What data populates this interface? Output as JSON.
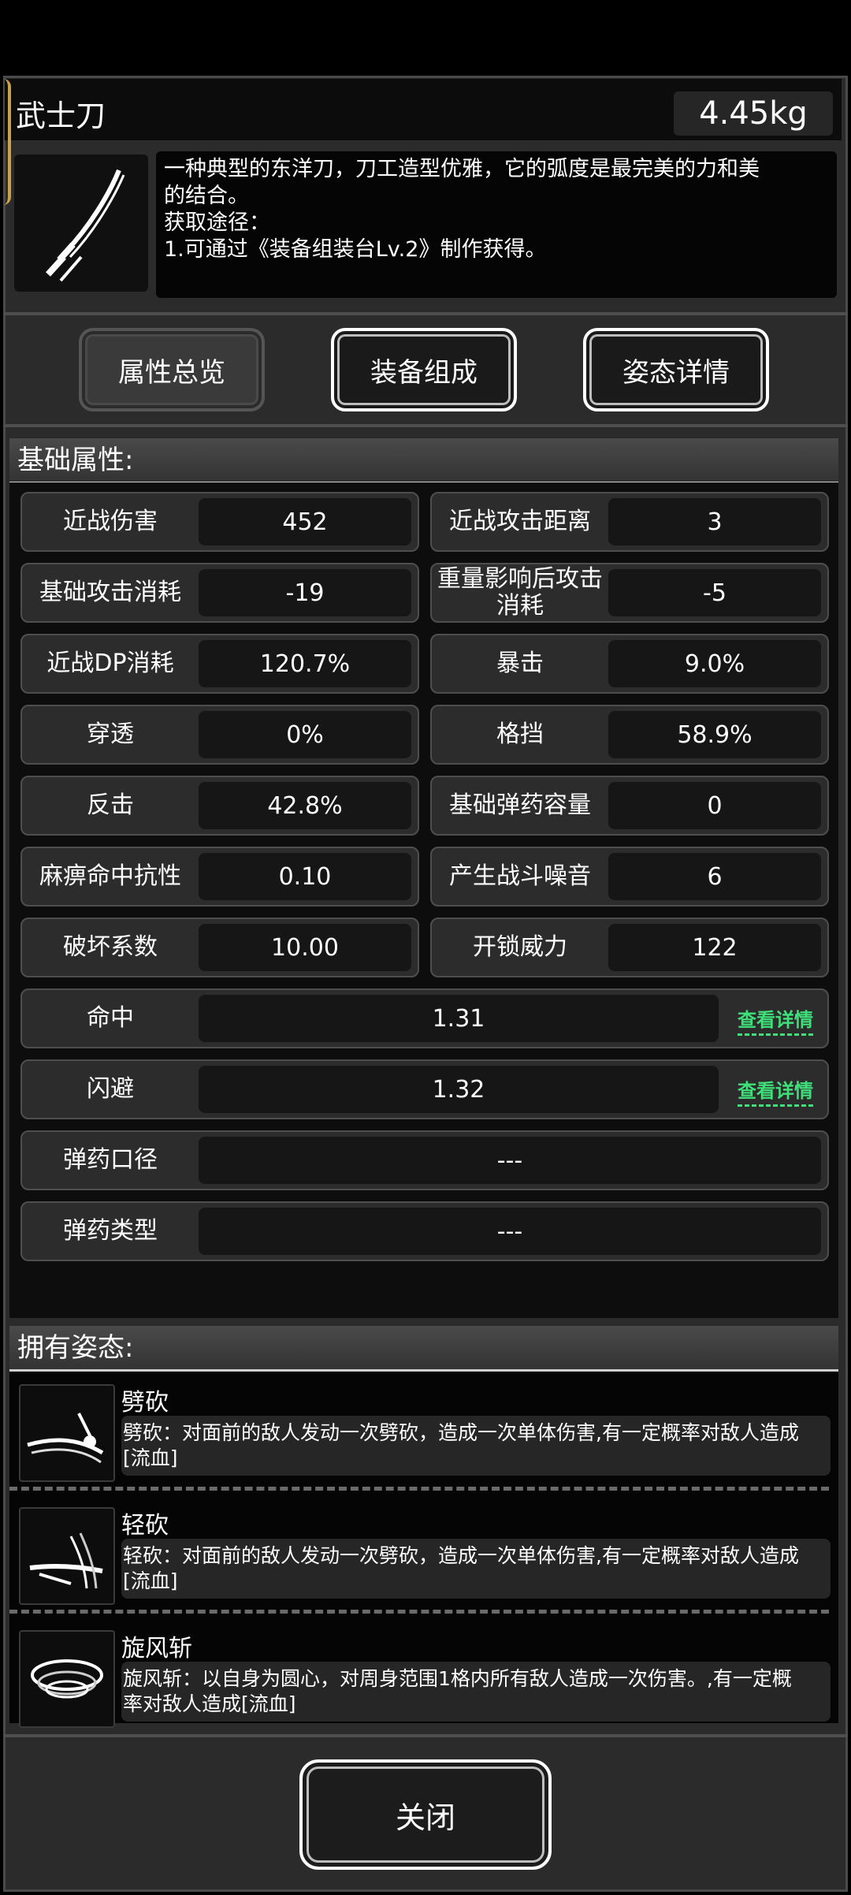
{
  "item": {
    "name": "武士刀",
    "weight": "4.45kg",
    "icon": "katana-icon",
    "description": [
      "一种典型的东洋刀，刀工造型优雅，它的弧度是最完美的力和美",
      "的结合。",
      "获取途径：",
      "1.可通过《装备组装台Lv.2》制作获得。"
    ]
  },
  "tabs": [
    {
      "label": "属性总览",
      "state": "inactive"
    },
    {
      "label": "装备组成",
      "state": "active"
    },
    {
      "label": "姿态详情",
      "state": "active"
    }
  ],
  "attributes": {
    "title": "基础属性:",
    "pairs": [
      [
        {
          "label": "近战伤害",
          "value": "452"
        },
        {
          "label": "近战攻击距离",
          "value": "3"
        }
      ],
      [
        {
          "label": "基础攻击消耗",
          "value": "-19"
        },
        {
          "label": "重量影响后攻击消耗",
          "value": "-5"
        }
      ],
      [
        {
          "label": "近战DP消耗",
          "value": "120.7%"
        },
        {
          "label": "暴击",
          "value": "9.0%"
        }
      ],
      [
        {
          "label": "穿透",
          "value": "0%"
        },
        {
          "label": "格挡",
          "value": "58.9%"
        }
      ],
      [
        {
          "label": "反击",
          "value": "42.8%"
        },
        {
          "label": "基础弹药容量",
          "value": "0"
        }
      ],
      [
        {
          "label": "麻痹命中抗性",
          "value": "0.10"
        },
        {
          "label": "产生战斗噪音",
          "value": "6"
        }
      ],
      [
        {
          "label": "破坏系数",
          "value": "10.00"
        },
        {
          "label": "开锁威力",
          "value": "122"
        }
      ]
    ],
    "full": [
      {
        "label": "命中",
        "value": "1.31",
        "link": "查看详情"
      },
      {
        "label": "闪避",
        "value": "1.32",
        "link": "查看详情"
      },
      {
        "label": "弹药口径",
        "value": "---"
      },
      {
        "label": "弹药类型",
        "value": "---"
      }
    ]
  },
  "stances": {
    "title": "拥有姿态:",
    "items": [
      {
        "name": "劈砍",
        "icon": "slash-icon",
        "desc": [
          "劈砍：对面前的敌人发动一次劈砍，造成一次单体伤害,有一定概率对敌人造成",
          "[流血]"
        ]
      },
      {
        "name": "轻砍",
        "icon": "light-slash-icon",
        "desc": [
          "轻砍：对面前的敌人发动一次劈砍，造成一次单体伤害,有一定概率对敌人造成",
          "[流血]"
        ]
      },
      {
        "name": "旋风斩",
        "icon": "whirlwind-icon",
        "desc": [
          "旋风斩：以自身为圆心，对周身范围1格内所有敌人造成一次伤害。,有一定概",
          "率对敌人造成[流血]"
        ]
      }
    ]
  },
  "close_label": "关闭"
}
